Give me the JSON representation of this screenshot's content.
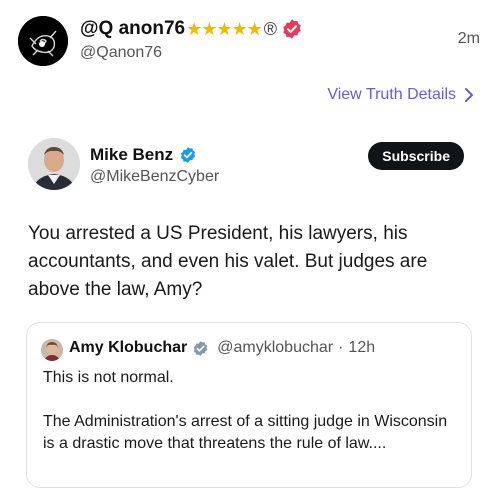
{
  "post": {
    "display_name": "@Q anon76",
    "stars": "★★★★★",
    "registered_mark": "®",
    "handle": "@Qanon76",
    "timestamp": "2m",
    "verified_color": "#e8395c"
  },
  "view_details": {
    "label": "View Truth Details",
    "color": "#6b5bd6"
  },
  "tweet": {
    "author_name": "Mike Benz",
    "author_handle": "@MikeBenzCyber",
    "subscribe_label": "Subscribe",
    "text": "You arrested a US President, his lawyers, his accountants, and even his valet. But judges are above the law, Amy?",
    "verified_color": "#1d9bf0"
  },
  "quote": {
    "author_name": "Amy Klobuchar",
    "author_handle": "@amyklobuchar",
    "separator": "·",
    "time": "12h",
    "verified_color": "#829aab",
    "paragraphs": [
      "This is not normal.",
      "The Administration's arrest of a sitting judge in Wisconsin is a drastic move that threatens the rule of law...."
    ]
  }
}
